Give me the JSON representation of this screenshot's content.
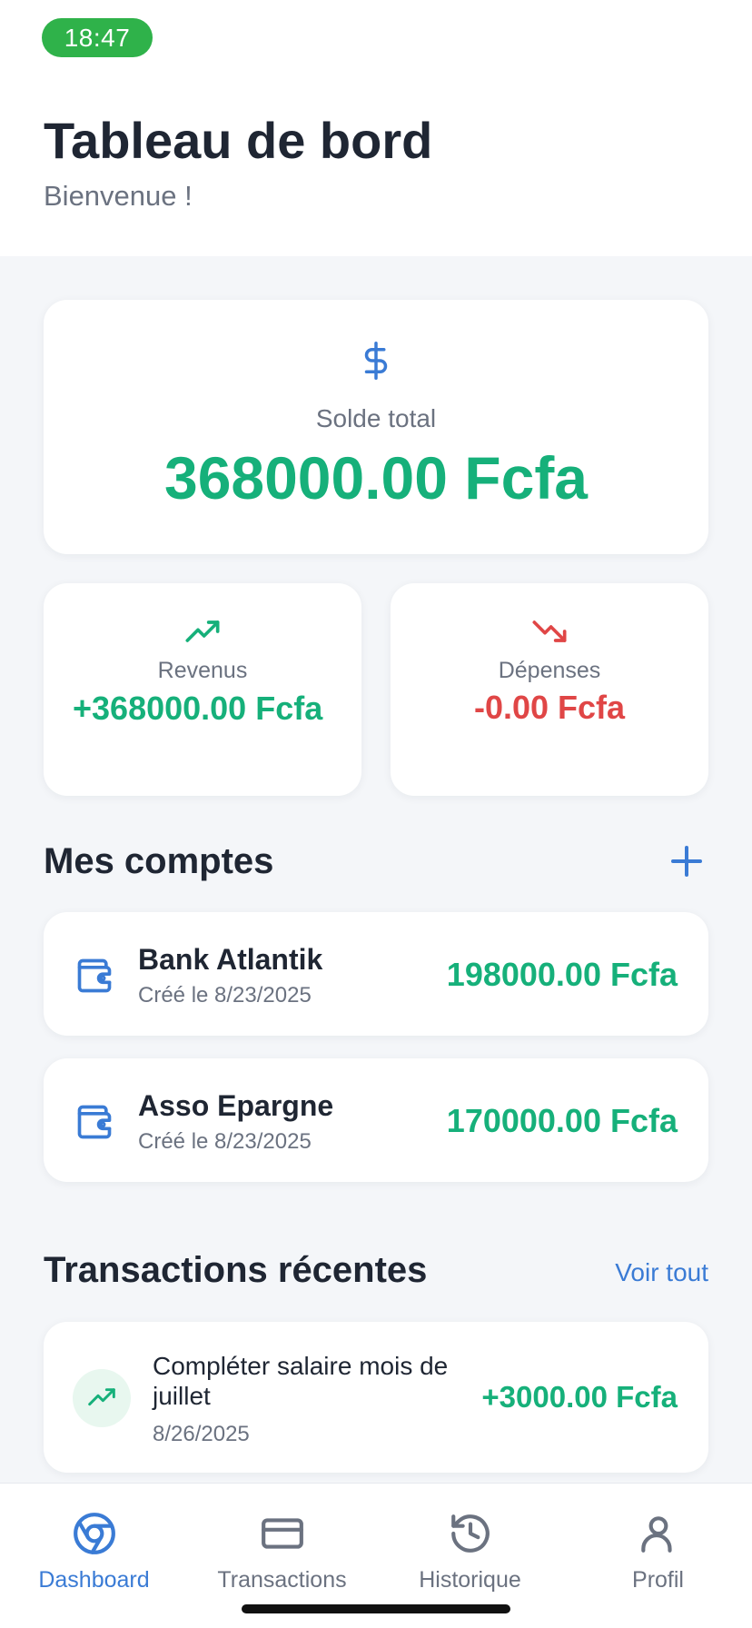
{
  "status_bar": {
    "time": "18:47"
  },
  "header": {
    "title": "Tableau de bord",
    "subtitle": "Bienvenue !"
  },
  "balance": {
    "icon": "dollar-icon",
    "label": "Solde total",
    "amount": "368000.00 Fcfa"
  },
  "stats": {
    "income": {
      "icon": "trending-up-icon",
      "label": "Revenus",
      "value": "+368000.00 Fcfa"
    },
    "expenses": {
      "icon": "trending-down-icon",
      "label": "Dépenses",
      "value": "-0.00 Fcfa"
    }
  },
  "accounts": {
    "title": "Mes comptes",
    "add_icon": "plus-icon",
    "items": [
      {
        "name": "Bank Atlantik",
        "created": "Créé le 8/23/2025",
        "amount": "198000.00 Fcfa"
      },
      {
        "name": "Asso Epargne",
        "created": "Créé le 8/23/2025",
        "amount": "170000.00 Fcfa"
      }
    ]
  },
  "transactions": {
    "title": "Transactions récentes",
    "see_all": "Voir tout",
    "items": [
      {
        "description": "Compléter salaire mois de juillet",
        "date": "8/26/2025",
        "amount": "+3000.00 Fcfa"
      }
    ]
  },
  "nav": {
    "items": [
      {
        "label": "Dashboard",
        "icon": "dashboard-icon",
        "active": true
      },
      {
        "label": "Transactions",
        "icon": "card-icon",
        "active": false
      },
      {
        "label": "Historique",
        "icon": "history-icon",
        "active": false
      },
      {
        "label": "Profil",
        "icon": "user-icon",
        "active": false
      }
    ]
  },
  "colors": {
    "accent": "#3a7bd5",
    "positive": "#16b07a",
    "negative": "#e04646",
    "status_pill": "#2fb24a"
  }
}
